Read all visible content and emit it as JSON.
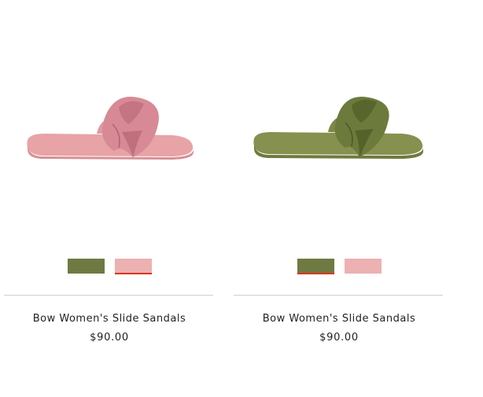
{
  "products": [
    {
      "name": "Bow Women's Slide Sandals",
      "price": "$90.00",
      "image_color": "#e8a0a0",
      "bow_color": "#d98a94",
      "swatches": [
        {
          "color": "#6f7a43",
          "selected": false
        },
        {
          "color": "#edb1b1",
          "selected": true
        }
      ]
    },
    {
      "name": "Bow Women's Slide Sandals",
      "price": "$90.00",
      "image_color": "#7f8a4e",
      "bow_color": "#6c7a3b",
      "swatches": [
        {
          "color": "#6f7a43",
          "selected": true
        },
        {
          "color": "#edb1b1",
          "selected": false
        }
      ]
    }
  ],
  "accent_color": "#d9361c"
}
